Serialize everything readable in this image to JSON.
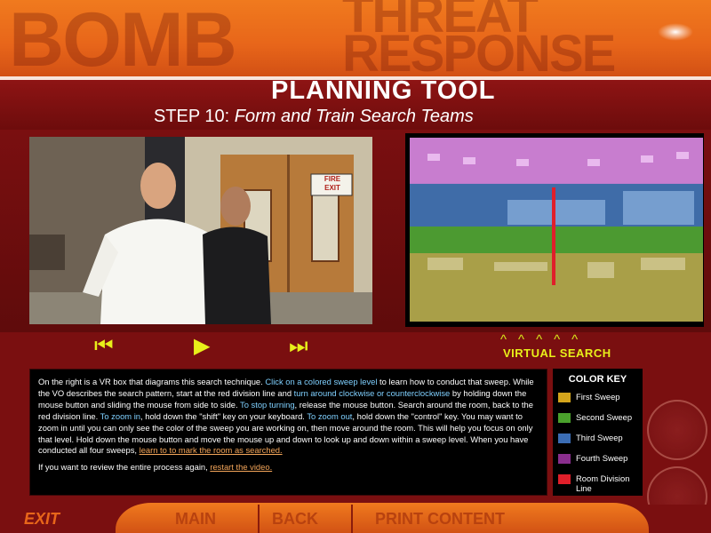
{
  "header": {
    "word_bomb": "BOMB",
    "word_threat": "THREAT",
    "word_response": "RESPONSE",
    "title": "PLANNING TOOL",
    "step_prefix": "STEP 10: ",
    "step_title": "Form and Train Search Teams"
  },
  "video_controls": {
    "rewind_icon": "⏮",
    "play_icon": "▶",
    "forward_icon": "⏭"
  },
  "exit_sign": {
    "line1": "FIRE",
    "line2": "EXIT"
  },
  "virtual_search": {
    "arrows": "^^^^^",
    "label": "VIRTUAL SEARCH"
  },
  "instructions": {
    "p1_a": "On the right is a VR box that diagrams this search technique. ",
    "p1_b": "Click on a colored sweep level",
    "p1_c": " to learn how to conduct that sweep.  While the VO describes the search pattern, start at the red division line and ",
    "p1_d": "turn around clockwise or counterclockwise",
    "p1_e": " by holding down the mouse button and sliding the mouse from side to side. ",
    "p1_f": "To stop turning",
    "p1_g": ", release the mouse button.  Search around the room, back to the red division line. ",
    "p1_h": "To zoom in",
    "p1_i": ", hold down the \"shift\" key on your keyboard. ",
    "p1_j": "To zoom out",
    "p1_k": ", hold down the \"control\" key.  You may want to zoom in until you can only see the color of the sweep you are working on, then move around the room.  This will help you focus on only that level. Hold down the mouse button and move the mouse up and down to look up and down within a sweep level. When you have conducted all four sweeps, ",
    "p1_l": "learn to to mark the room as searched.",
    "p2_a": "If you want to review the entire process again, ",
    "p2_b": "restart the video."
  },
  "color_key": {
    "title": "COLOR KEY",
    "items": [
      {
        "label": "First Sweep",
        "color": "#d4a51c"
      },
      {
        "label": "Second Sweep",
        "color": "#4aa12c"
      },
      {
        "label": "Third Sweep",
        "color": "#3b6db4"
      },
      {
        "label": "Fourth Sweep",
        "color": "#8a2e8e"
      },
      {
        "label": "Room Division Line",
        "color": "#e01f2a"
      }
    ]
  },
  "bottom_nav": {
    "exit": "EXIT",
    "main": "MAIN",
    "back": "BACK",
    "print": "PRINT CONTENT"
  },
  "colors": {
    "header_orange": "#e8661a",
    "background_red": "#7a0f10",
    "highlight_blue": "#7fd0ff",
    "link_orange": "#f4a65a",
    "control_yellow": "#e8ef1a"
  }
}
